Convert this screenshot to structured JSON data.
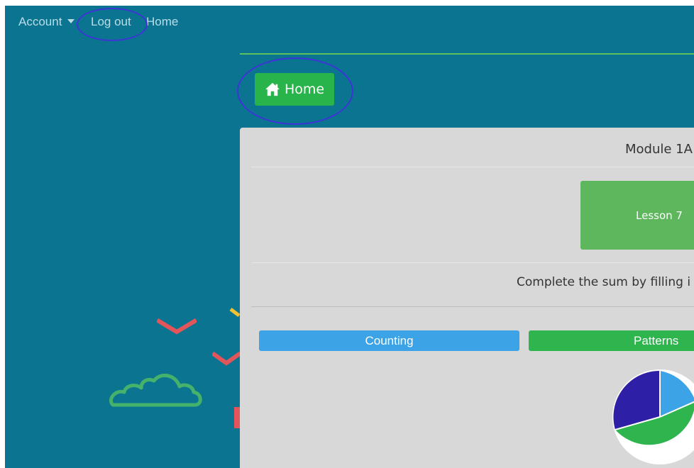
{
  "nav": {
    "account_label": "Account",
    "logout_label": "Log out",
    "home_label": "Home"
  },
  "home_button": {
    "label": "Home",
    "icon": "home-icon"
  },
  "card": {
    "module_title": "Module 1A",
    "lesson_label": "Lesson 7",
    "instruction": "Complete the sum by filling i",
    "buttons": [
      {
        "label": "Counting",
        "color": "#3ba3e6"
      },
      {
        "label": "Patterns",
        "color": "#2eb54d"
      }
    ]
  },
  "colors": {
    "background": "#0b7490",
    "card": "#d8d8d8",
    "accent_green": "#28b44b",
    "lesson_green": "#5eb75d",
    "annotation_ring": "#3d35d6",
    "pie": [
      "#3ba3e6",
      "#2eb54d",
      "#2d1fa6"
    ]
  }
}
